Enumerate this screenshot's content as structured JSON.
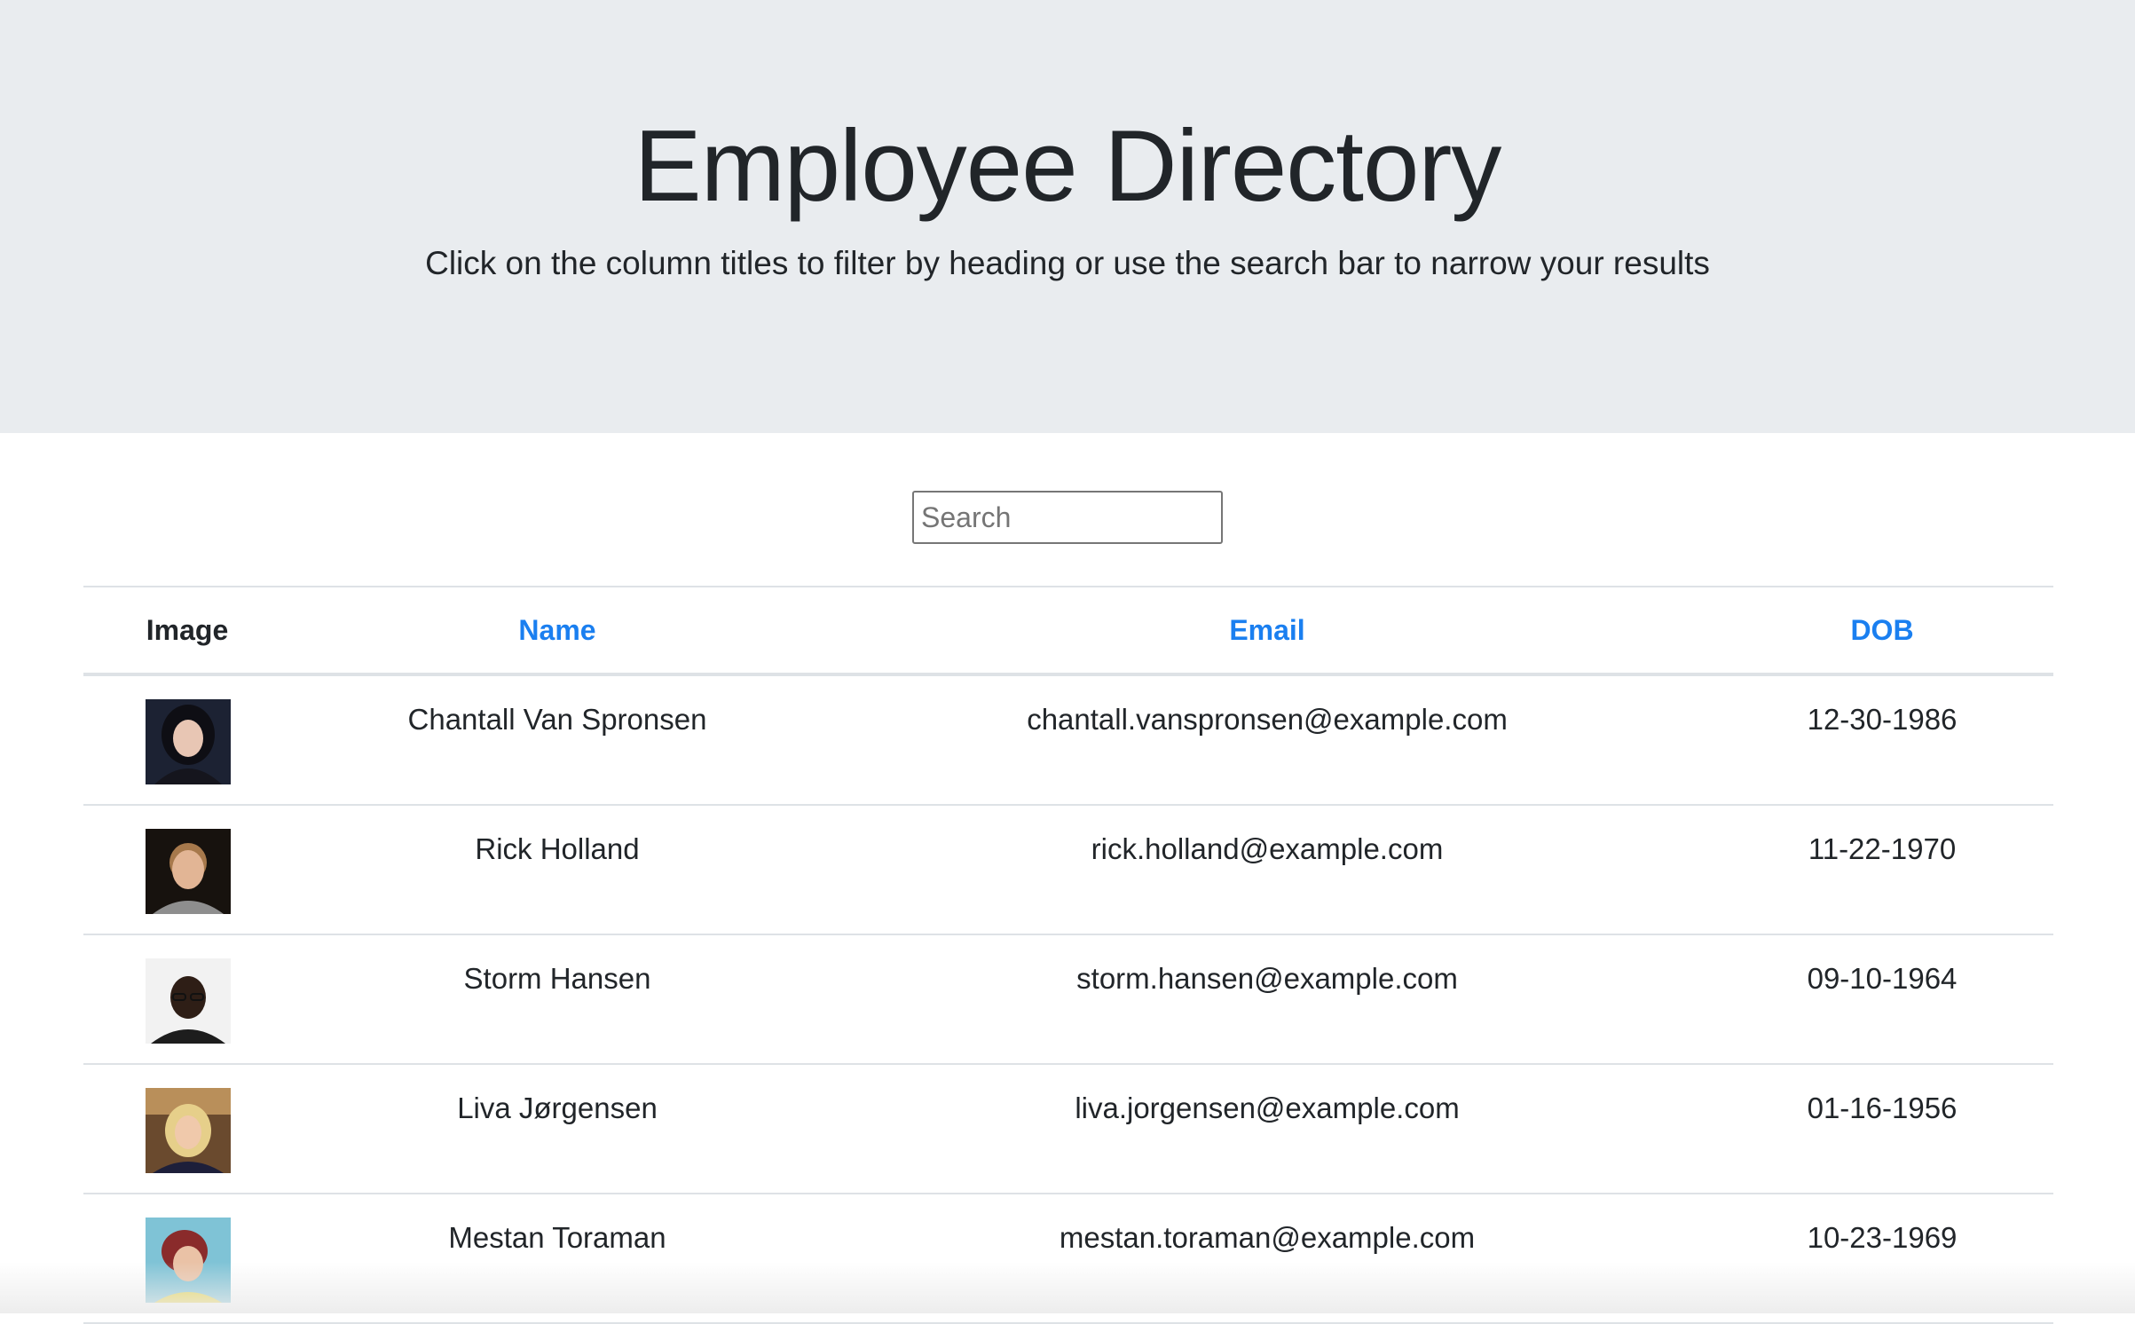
{
  "header": {
    "title": "Employee Directory",
    "subtitle": "Click on the column titles to filter by heading or use the search bar to narrow your results"
  },
  "search": {
    "placeholder": "Search",
    "value": ""
  },
  "table": {
    "columns": [
      "Image",
      "Name",
      "Email",
      "DOB"
    ],
    "rows": [
      {
        "name": "Chantall Van Spronsen",
        "email": "chantall.vanspronsen@example.com",
        "dob": "12-30-1986"
      },
      {
        "name": "Rick Holland",
        "email": "rick.holland@example.com",
        "dob": "11-22-1970"
      },
      {
        "name": "Storm Hansen",
        "email": "storm.hansen@example.com",
        "dob": "09-10-1964"
      },
      {
        "name": "Liva Jørgensen",
        "email": "liva.jorgensen@example.com",
        "dob": "01-16-1956"
      },
      {
        "name": "Mestan Toraman",
        "email": "mestan.toraman@example.com",
        "dob": "10-23-1969"
      }
    ]
  },
  "colors": {
    "jumbotron_bg": "#e9ecef",
    "link": "#1a7ff0",
    "border": "#dee2e6"
  }
}
